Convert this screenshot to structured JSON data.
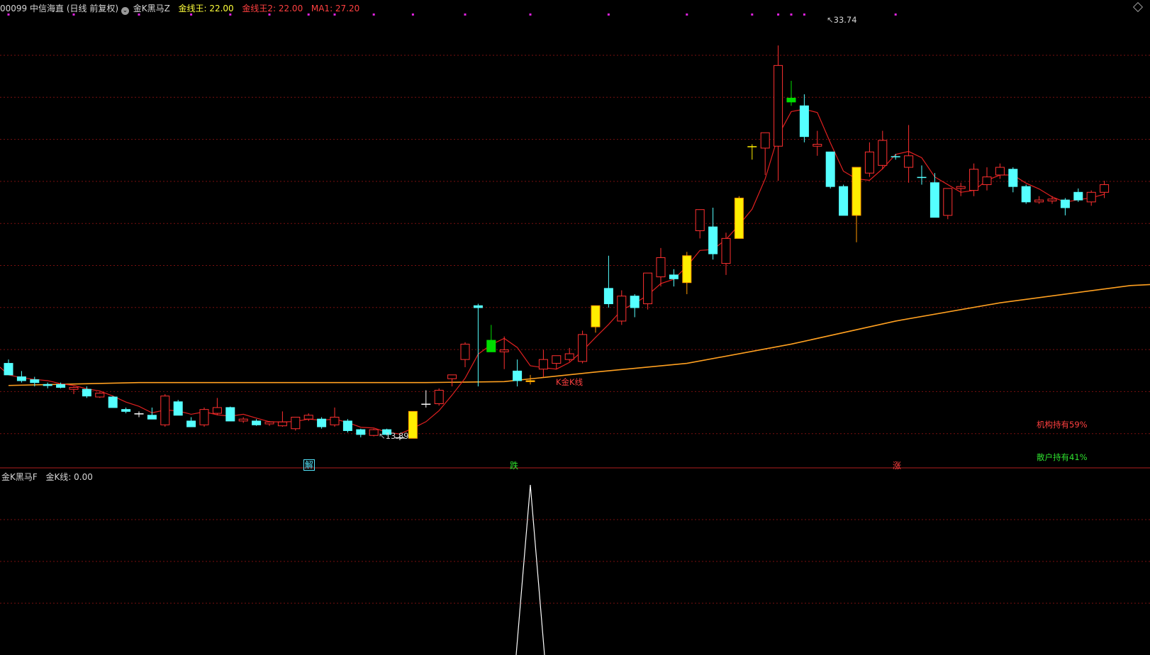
{
  "header": {
    "code": "00099",
    "stock_name": "中信海直",
    "period": "(日线 前复权)",
    "indicator_name": "金K黑马Z",
    "gold_line_label": "金线王",
    "gold_line_value": "22.00",
    "gold_line2_label": "金线王2",
    "gold_line2_value": "22.00",
    "ma_label": "MA1",
    "ma_value": "27.20"
  },
  "subpanel": {
    "indicator_name": "金K黑马F",
    "line_label": "金K线",
    "line_value": "0.00"
  },
  "annotations": {
    "high_label": "33.74",
    "low_label": "13.89",
    "gold_k_label": "K金K线",
    "inst_holding": "机构持有59%",
    "retail_holding": "散户持有41%"
  },
  "signals": [
    {
      "text": "解",
      "color": "#55e8ff"
    },
    {
      "text": "跌",
      "color": "#2ee02e"
    },
    {
      "text": "涨",
      "color": "#ff4040"
    }
  ],
  "colors": {
    "up": "#ff3030",
    "down": "#55ffff",
    "gold": "#ffee00",
    "green": "#00dd00",
    "ma_short": "#e02020",
    "ma_long": "#ffa020",
    "grid": "#7a1010",
    "signal_dot": "#dd22dd"
  },
  "chart_data": {
    "type": "candlestick",
    "yrange": [
      12.5,
      35.0
    ],
    "lowest_low": 13.89,
    "highest_high": 33.74,
    "candles": [
      {
        "o": 17.2,
        "h": 17.4,
        "l": 16.6,
        "c": 16.6,
        "k": "down"
      },
      {
        "o": 16.5,
        "h": 16.8,
        "l": 16.2,
        "c": 16.3,
        "k": "down"
      },
      {
        "o": 16.35,
        "h": 16.5,
        "l": 16.0,
        "c": 16.2,
        "k": "down"
      },
      {
        "o": 16.1,
        "h": 16.2,
        "l": 15.9,
        "c": 16.1,
        "k": "down"
      },
      {
        "o": 16.1,
        "h": 16.2,
        "l": 15.9,
        "c": 15.95,
        "k": "down"
      },
      {
        "o": 15.85,
        "h": 16.0,
        "l": 15.6,
        "c": 15.95,
        "k": "up"
      },
      {
        "o": 15.85,
        "h": 16.0,
        "l": 15.4,
        "c": 15.5,
        "k": "down"
      },
      {
        "o": 15.45,
        "h": 15.7,
        "l": 15.4,
        "c": 15.65,
        "k": "up"
      },
      {
        "o": 15.45,
        "h": 15.5,
        "l": 14.9,
        "c": 14.9,
        "k": "down"
      },
      {
        "o": 14.8,
        "h": 14.9,
        "l": 14.6,
        "c": 14.7,
        "k": "down"
      },
      {
        "o": 14.6,
        "h": 14.7,
        "l": 14.4,
        "c": 14.6,
        "k": "cross"
      },
      {
        "o": 14.5,
        "h": 14.9,
        "l": 14.3,
        "c": 14.3,
        "k": "down"
      },
      {
        "o": 14.0,
        "h": 15.6,
        "l": 13.9,
        "c": 15.5,
        "k": "up"
      },
      {
        "o": 15.2,
        "h": 15.3,
        "l": 14.5,
        "c": 14.5,
        "k": "down"
      },
      {
        "o": 14.2,
        "h": 14.4,
        "l": 13.9,
        "c": 13.9,
        "k": "down"
      },
      {
        "o": 14.0,
        "h": 14.9,
        "l": 13.9,
        "c": 14.8,
        "k": "up"
      },
      {
        "o": 14.6,
        "h": 15.4,
        "l": 14.5,
        "c": 14.9,
        "k": "up"
      },
      {
        "o": 14.9,
        "h": 14.95,
        "l": 14.2,
        "c": 14.2,
        "k": "down"
      },
      {
        "o": 14.2,
        "h": 14.4,
        "l": 14.1,
        "c": 14.3,
        "k": "up"
      },
      {
        "o": 14.2,
        "h": 14.3,
        "l": 13.95,
        "c": 14.0,
        "k": "down"
      },
      {
        "o": 14.05,
        "h": 14.2,
        "l": 13.95,
        "c": 14.15,
        "k": "up"
      },
      {
        "o": 13.95,
        "h": 14.7,
        "l": 13.9,
        "c": 14.15,
        "k": "up"
      },
      {
        "o": 13.8,
        "h": 14.4,
        "l": 13.7,
        "c": 14.4,
        "k": "up"
      },
      {
        "o": 14.3,
        "h": 14.6,
        "l": 14.2,
        "c": 14.5,
        "k": "up"
      },
      {
        "o": 14.3,
        "h": 14.4,
        "l": 13.8,
        "c": 13.9,
        "k": "down"
      },
      {
        "o": 14.0,
        "h": 14.9,
        "l": 13.9,
        "c": 14.4,
        "k": "up"
      },
      {
        "o": 14.2,
        "h": 14.3,
        "l": 13.6,
        "c": 13.7,
        "k": "down"
      },
      {
        "o": 13.75,
        "h": 13.8,
        "l": 13.35,
        "c": 13.5,
        "k": "down"
      },
      {
        "o": 13.45,
        "h": 13.8,
        "l": 13.4,
        "c": 13.75,
        "k": "up"
      },
      {
        "o": 13.75,
        "h": 13.8,
        "l": 13.45,
        "c": 13.5,
        "k": "down"
      },
      {
        "o": 13.3,
        "h": 13.45,
        "l": 13.2,
        "c": 13.35,
        "k": "cross"
      },
      {
        "o": 13.3,
        "h": 14.7,
        "l": 13.3,
        "c": 14.7,
        "k": "gold"
      },
      {
        "o": 15.1,
        "h": 15.8,
        "l": 14.9,
        "c": 15.1,
        "k": "cross"
      },
      {
        "o": 15.1,
        "h": 15.9,
        "l": 15.0,
        "c": 15.8,
        "k": "up"
      },
      {
        "o": 16.4,
        "h": 16.6,
        "l": 16.0,
        "c": 16.6,
        "k": "up"
      },
      {
        "o": 17.4,
        "h": 18.3,
        "l": 17.0,
        "c": 18.2,
        "k": "up"
      },
      {
        "o": 20.2,
        "h": 20.3,
        "l": 16.0,
        "c": 20.1,
        "k": "down"
      },
      {
        "o": 18.4,
        "h": 19.2,
        "l": 17.8,
        "c": 17.8,
        "k": "green"
      },
      {
        "o": 17.8,
        "h": 18.6,
        "l": 16.9,
        "c": 17.9,
        "k": "up"
      },
      {
        "o": 16.8,
        "h": 17.4,
        "l": 16.0,
        "c": 16.3,
        "k": "down"
      },
      {
        "o": 16.3,
        "h": 16.6,
        "l": 16.1,
        "c": 16.3,
        "k": "gold"
      },
      {
        "o": 16.9,
        "h": 17.9,
        "l": 16.5,
        "c": 17.4,
        "k": "up"
      },
      {
        "o": 17.2,
        "h": 17.6,
        "l": 16.9,
        "c": 17.6,
        "k": "up"
      },
      {
        "o": 17.4,
        "h": 18.0,
        "l": 17.3,
        "c": 17.7,
        "k": "up"
      },
      {
        "o": 17.3,
        "h": 18.9,
        "l": 17.2,
        "c": 18.7,
        "k": "up"
      },
      {
        "o": 19.1,
        "h": 20.2,
        "l": 18.8,
        "c": 20.2,
        "k": "gold"
      },
      {
        "o": 21.1,
        "h": 22.8,
        "l": 20.1,
        "c": 20.3,
        "k": "down"
      },
      {
        "o": 19.4,
        "h": 21.0,
        "l": 19.2,
        "c": 20.7,
        "k": "up"
      },
      {
        "o": 20.7,
        "h": 20.8,
        "l": 19.6,
        "c": 20.1,
        "k": "down"
      },
      {
        "o": 20.3,
        "h": 21.8,
        "l": 20.0,
        "c": 21.9,
        "k": "up"
      },
      {
        "o": 21.7,
        "h": 23.2,
        "l": 21.2,
        "c": 22.7,
        "k": "up"
      },
      {
        "o": 21.8,
        "h": 22.1,
        "l": 21.2,
        "c": 21.6,
        "k": "down"
      },
      {
        "o": 21.4,
        "h": 23.0,
        "l": 20.8,
        "c": 22.8,
        "k": "gold"
      },
      {
        "o": 24.1,
        "h": 25.2,
        "l": 23.7,
        "c": 25.2,
        "k": "up"
      },
      {
        "o": 24.3,
        "h": 25.3,
        "l": 22.6,
        "c": 22.9,
        "k": "down"
      },
      {
        "o": 22.4,
        "h": 24.0,
        "l": 21.8,
        "c": 23.7,
        "k": "up"
      },
      {
        "o": 23.7,
        "h": 25.9,
        "l": 23.7,
        "c": 25.8,
        "k": "gold"
      },
      {
        "o": 28.5,
        "h": 28.6,
        "l": 27.8,
        "c": 28.5,
        "k": "cross-y"
      },
      {
        "o": 28.4,
        "h": 29.2,
        "l": 27.0,
        "c": 29.2,
        "k": "up"
      },
      {
        "o": 28.5,
        "h": 33.74,
        "l": 26.7,
        "c": 32.7,
        "k": "up"
      },
      {
        "o": 31.0,
        "h": 31.9,
        "l": 30.6,
        "c": 30.8,
        "k": "green"
      },
      {
        "o": 30.6,
        "h": 31.2,
        "l": 28.7,
        "c": 29.0,
        "k": "down"
      },
      {
        "o": 28.6,
        "h": 29.3,
        "l": 28.0,
        "c": 28.5,
        "k": "up"
      },
      {
        "o": 28.2,
        "h": 28.2,
        "l": 26.3,
        "c": 26.4,
        "k": "down"
      },
      {
        "o": 26.4,
        "h": 26.5,
        "l": 24.9,
        "c": 24.9,
        "k": "down"
      },
      {
        "o": 24.9,
        "h": 27.4,
        "l": 23.5,
        "c": 27.4,
        "k": "gold"
      },
      {
        "o": 27.1,
        "h": 28.7,
        "l": 26.9,
        "c": 28.2,
        "k": "up"
      },
      {
        "o": 27.5,
        "h": 29.3,
        "l": 27.3,
        "c": 28.8,
        "k": "up"
      },
      {
        "o": 28.0,
        "h": 28.1,
        "l": 27.8,
        "c": 27.9,
        "k": "cross-c"
      },
      {
        "o": 27.4,
        "h": 29.6,
        "l": 26.6,
        "c": 28.0,
        "k": "up"
      },
      {
        "o": 26.9,
        "h": 27.5,
        "l": 26.5,
        "c": 26.9,
        "k": "cross-c"
      },
      {
        "o": 26.6,
        "h": 27.1,
        "l": 24.8,
        "c": 24.8,
        "k": "down"
      },
      {
        "o": 24.9,
        "h": 26.3,
        "l": 24.7,
        "c": 26.3,
        "k": "up"
      },
      {
        "o": 26.3,
        "h": 26.6,
        "l": 25.9,
        "c": 26.4,
        "k": "up"
      },
      {
        "o": 26.2,
        "h": 27.6,
        "l": 25.9,
        "c": 27.3,
        "k": "up"
      },
      {
        "o": 26.5,
        "h": 27.4,
        "l": 26.2,
        "c": 26.9,
        "k": "up"
      },
      {
        "o": 27.0,
        "h": 27.6,
        "l": 26.8,
        "c": 27.4,
        "k": "up"
      },
      {
        "o": 27.3,
        "h": 27.4,
        "l": 26.1,
        "c": 26.4,
        "k": "down"
      },
      {
        "o": 26.4,
        "h": 26.5,
        "l": 25.5,
        "c": 25.6,
        "k": "down"
      },
      {
        "o": 25.6,
        "h": 25.9,
        "l": 25.5,
        "c": 25.7,
        "k": "up"
      },
      {
        "o": 25.65,
        "h": 25.9,
        "l": 25.5,
        "c": 25.75,
        "k": "up"
      },
      {
        "o": 25.7,
        "h": 25.8,
        "l": 24.9,
        "c": 25.3,
        "k": "down"
      },
      {
        "o": 25.7,
        "h": 26.3,
        "l": 25.6,
        "c": 26.1,
        "k": "down"
      },
      {
        "o": 25.6,
        "h": 26.2,
        "l": 25.4,
        "c": 26.1,
        "k": "up"
      },
      {
        "o": 26.1,
        "h": 26.7,
        "l": 25.8,
        "c": 26.5,
        "k": "up"
      }
    ],
    "ma_long_points": [
      [
        0,
        16.05
      ],
      [
        10,
        16.2
      ],
      [
        20,
        16.2
      ],
      [
        32,
        16.2
      ],
      [
        38,
        16.25
      ],
      [
        45,
        16.75
      ],
      [
        52,
        17.2
      ],
      [
        60,
        18.2
      ],
      [
        68,
        19.4
      ],
      [
        76,
        20.35
      ],
      [
        86,
        21.25
      ]
    ],
    "signal_dots_x": [
      0,
      5,
      10,
      14,
      17,
      20,
      23,
      25,
      28,
      31,
      35,
      40,
      46,
      52,
      57,
      59,
      60,
      61,
      68
    ],
    "sub_indicator": {
      "peak_index": 40,
      "peak_value": 1.0,
      "baseline": 0.0
    }
  }
}
